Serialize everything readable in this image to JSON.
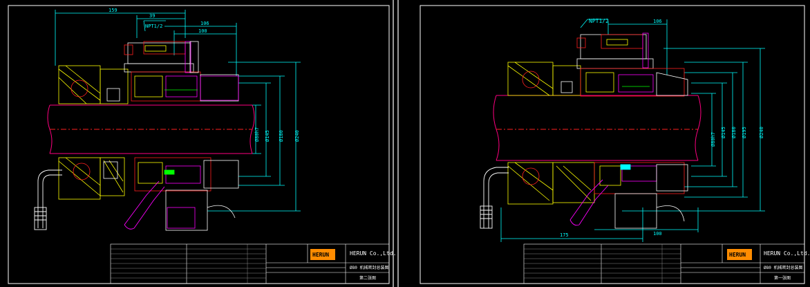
{
  "colors": {
    "background": "#000000",
    "frame": "#ffffff",
    "dimension": "#00ffff",
    "part_red": "#ff2020",
    "part_yellow": "#ffff00",
    "part_magenta": "#ff00ff",
    "part_green": "#00ff00",
    "part_white": "#ffffff",
    "shaft": "#ff0080"
  },
  "sheet_left": {
    "dims": {
      "top_overall": "159",
      "port_offset": "39",
      "port_label": "NPT1/2",
      "len_106": "106",
      "len_100": "100",
      "dia_shaft": "Ø80h7",
      "dia_145": "Ø145",
      "dia_180": "Ø180",
      "dia_240": "Ø240"
    },
    "title_block": {
      "company": "HERUN Co.,Ltd.",
      "logo": "HERUN",
      "drawing_title": "Ø80 机械密封总装图",
      "sheet_no": "第二张图"
    }
  },
  "sheet_right": {
    "dims": {
      "port_label": "NPT1/2",
      "len_106": "106",
      "bottom_175": "175",
      "bottom_100": "100",
      "dia_shaft": "Ø80h7",
      "dia_145": "Ø145",
      "dia_180": "Ø180",
      "dia_195": "Ø195",
      "dia_240": "Ø240"
    },
    "title_block": {
      "company": "HERUN Co.,Ltd.",
      "logo": "HERUN",
      "drawing_title": "Ø80 机械密封总装图",
      "sheet_no": "第一张图"
    }
  }
}
